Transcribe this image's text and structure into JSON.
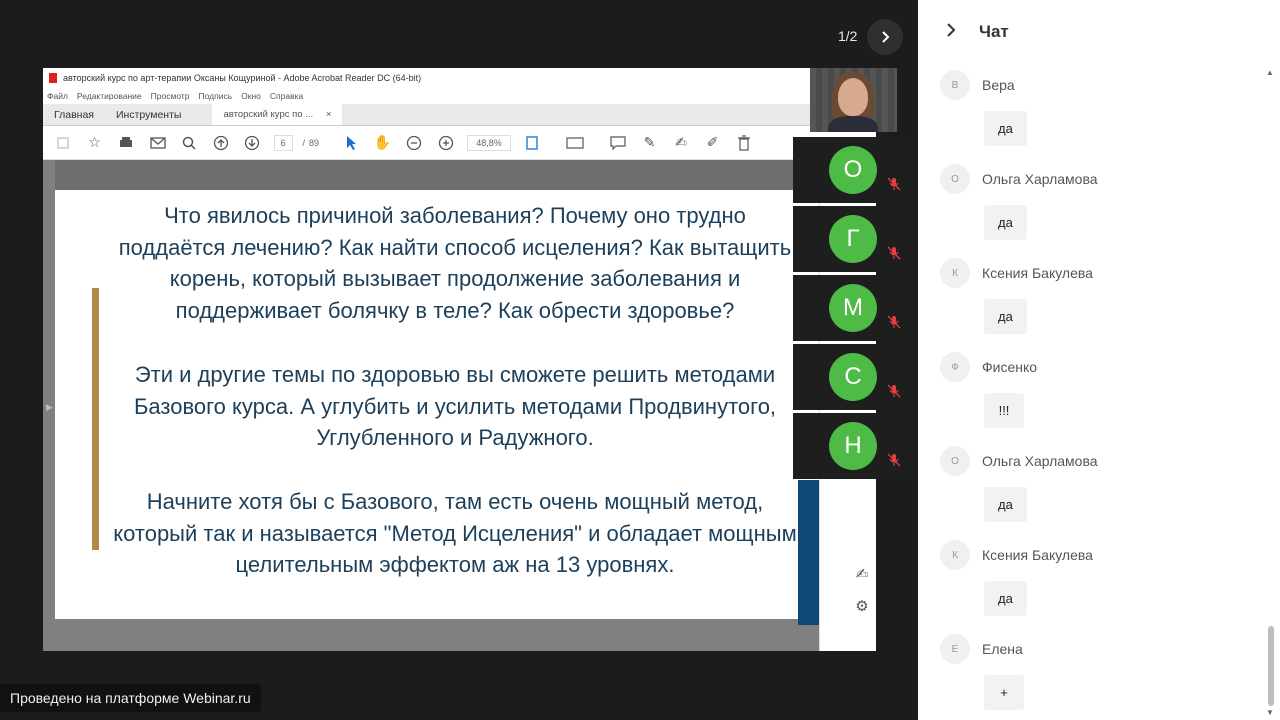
{
  "slide": {
    "counter": "1/2"
  },
  "acrobat": {
    "window_title": "авторский курс по арт-терапии Оксаны Кощуриной - Adobe Acrobat Reader DC (64-bit)",
    "menu": [
      "Файл",
      "Редактирование",
      "Просмотр",
      "Подпись",
      "Окно",
      "Справка"
    ],
    "tabs": {
      "home": "Главная",
      "tools": "Инструменты",
      "doc": "авторский курс по ...",
      "doc_close": "×"
    },
    "toolbar": {
      "page_current": "6",
      "page_sep": "/",
      "page_total": "89",
      "zoom": "48,8%"
    },
    "document": {
      "paragraph1": "Что явилось причиной заболевания? Почему оно трудно поддаётся лечению? Как найти способ исцеления? Как вытащить корень, который вызывает продолжение заболевания и поддерживает болячку в теле? Как обрести здоровье?",
      "paragraph2": "Эти и другие темы по здоровью вы сможете решить методами Базового курса. А углубить и усилить методами Продвинутого, Углубленного и Радужного.",
      "paragraph3": "Начните хотя бы с Базового, там есть очень мощный метод, который так и называется \"Метод Исцеления\" и обладает мощным целительным эффектом аж на 13 уровнях."
    }
  },
  "participants": [
    {
      "initial": "О"
    },
    {
      "initial": "Г"
    },
    {
      "initial": "М"
    },
    {
      "initial": "С"
    },
    {
      "initial": "Н"
    }
  ],
  "platform_badge": "Проведено на платформе Webinar.ru",
  "chat": {
    "title": "Чат",
    "messages": [
      {
        "avatar": "В",
        "author": "Вера",
        "text": "да"
      },
      {
        "avatar": "О",
        "author": "Ольга Харламова",
        "text": "да"
      },
      {
        "avatar": "К",
        "author": "Ксения Бакулева",
        "text": "да"
      },
      {
        "avatar": "Ф",
        "author": "Фисенко",
        "text": "!!!"
      },
      {
        "avatar": "О",
        "author": "Ольга Харламова",
        "text": "да"
      },
      {
        "avatar": "К",
        "author": "Ксения Бакулева",
        "text": "да"
      },
      {
        "avatar": "Е",
        "author": "Елена",
        "text": "+"
      }
    ]
  },
  "colors": {
    "participant_avatar": "#4dbb46",
    "doc_text": "#1d3f5a",
    "accent_bar": "#b08a45"
  }
}
